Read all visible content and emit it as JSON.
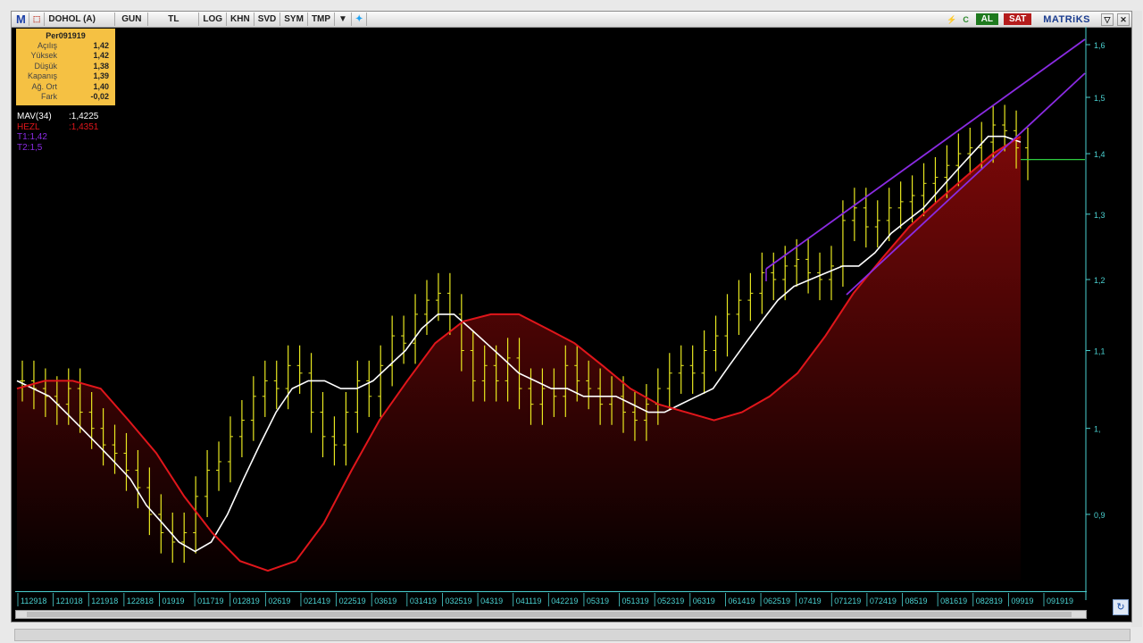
{
  "toolbar": {
    "logo": "M",
    "symbol": "DOHOL (A)",
    "buttons": [
      "GUN",
      "TL",
      "LOG",
      "KHN",
      "SVD",
      "SYM",
      "TMP"
    ],
    "al_label": "AL",
    "sat_label": "SAT",
    "brand": "MATRiKS"
  },
  "info_box": {
    "title": "Per091919",
    "rows": [
      {
        "label": "Açılış",
        "value": "1,42"
      },
      {
        "label": "Yüksek",
        "value": "1,42"
      },
      {
        "label": "Düşük",
        "value": "1,38"
      },
      {
        "label": "Kapanış",
        "value": "1,39"
      },
      {
        "label": "Ağ. Ort",
        "value": "1,40"
      },
      {
        "label": "Fark",
        "value": "-0,02"
      }
    ]
  },
  "legend": [
    {
      "label": "MAV(34)",
      "value": ":1,4225",
      "color": "#ffffff"
    },
    {
      "label": "HEZL",
      "value": ":1,4351",
      "color": "#e0161b"
    },
    {
      "label": "T1:1,42",
      "value": "",
      "color": "#8a2be2"
    },
    {
      "label": "T2:1,5",
      "value": "",
      "color": "#8a2be2"
    }
  ],
  "chart_data": {
    "type": "line",
    "price_axis": {
      "ticks": [
        0.9,
        1.0,
        1.1,
        1.2,
        1.3,
        1.4,
        1.5,
        1.6
      ],
      "tick_labels": [
        "0,9",
        "1,",
        "1,1",
        "1,2",
        "1,3",
        "1,4",
        "1,5",
        "1,6"
      ],
      "range": [
        0.83,
        1.6
      ],
      "scale": "log"
    },
    "date_labels": [
      "112918",
      "121018",
      "121918",
      "122818",
      "01919",
      "011719",
      "012819",
      "02619",
      "021419",
      "022519",
      "03619",
      "031419",
      "032519",
      "04319",
      "041119",
      "042219",
      "05319",
      "051319",
      "052319",
      "06319",
      "061419",
      "062519",
      "07419",
      "071219",
      "072419",
      "08519",
      "081619",
      "082819",
      "09919",
      "091919"
    ],
    "candle_color": "#e8e820",
    "price_closes": [
      1.06,
      1.05,
      1.04,
      1.03,
      1.05,
      1.02,
      1.0,
      0.98,
      0.97,
      0.95,
      0.93,
      0.9,
      0.88,
      0.87,
      0.88,
      0.92,
      0.95,
      0.96,
      0.99,
      1.01,
      1.04,
      1.06,
      1.05,
      1.08,
      1.07,
      1.02,
      0.99,
      0.98,
      1.02,
      1.06,
      1.04,
      1.08,
      1.12,
      1.11,
      1.15,
      1.17,
      1.18,
      1.15,
      1.1,
      1.06,
      1.08,
      1.06,
      1.09,
      1.05,
      1.03,
      1.05,
      1.04,
      1.08,
      1.06,
      1.05,
      1.03,
      1.04,
      1.02,
      1.01,
      1.03,
      1.05,
      1.07,
      1.08,
      1.07,
      1.1,
      1.12,
      1.15,
      1.17,
      1.18,
      1.21,
      1.2,
      1.22,
      1.23,
      1.21,
      1.2,
      1.22,
      1.29,
      1.31,
      1.28,
      1.29,
      1.31,
      1.32,
      1.33,
      1.35,
      1.36,
      1.38,
      1.4,
      1.41,
      1.42,
      1.45,
      1.44,
      1.41,
      1.39
    ],
    "series": [
      {
        "name": "MAV(34)",
        "color": "#ffffff",
        "values": [
          1.06,
          1.05,
          1.04,
          1.02,
          1.0,
          0.98,
          0.96,
          0.94,
          0.91,
          0.89,
          0.87,
          0.86,
          0.87,
          0.9,
          0.94,
          0.98,
          1.02,
          1.05,
          1.06,
          1.06,
          1.05,
          1.05,
          1.06,
          1.08,
          1.1,
          1.13,
          1.15,
          1.15,
          1.13,
          1.11,
          1.09,
          1.07,
          1.06,
          1.05,
          1.05,
          1.04,
          1.04,
          1.04,
          1.03,
          1.02,
          1.02,
          1.03,
          1.04,
          1.05,
          1.08,
          1.11,
          1.14,
          1.17,
          1.19,
          1.2,
          1.21,
          1.22,
          1.22,
          1.24,
          1.27,
          1.29,
          1.31,
          1.34,
          1.37,
          1.4,
          1.43,
          1.43,
          1.42
        ]
      },
      {
        "name": "HEZL",
        "color": "#e0161b",
        "values": [
          1.05,
          1.06,
          1.06,
          1.05,
          1.01,
          0.97,
          0.92,
          0.88,
          0.85,
          0.84,
          0.85,
          0.89,
          0.95,
          1.01,
          1.06,
          1.11,
          1.14,
          1.15,
          1.15,
          1.13,
          1.11,
          1.08,
          1.05,
          1.03,
          1.02,
          1.01,
          1.02,
          1.04,
          1.07,
          1.12,
          1.18,
          1.23,
          1.28,
          1.32,
          1.36,
          1.4,
          1.43
        ]
      }
    ],
    "trend_lines": [
      {
        "name": "T1",
        "value": "1,42",
        "color": "#8a2be2"
      },
      {
        "name": "T2",
        "value": "1,5",
        "color": "#8a2be2"
      }
    ],
    "horizontal_line": {
      "value": 1.39,
      "color": "#2ecc40"
    },
    "fill": "dark red gradient under HEZL"
  }
}
